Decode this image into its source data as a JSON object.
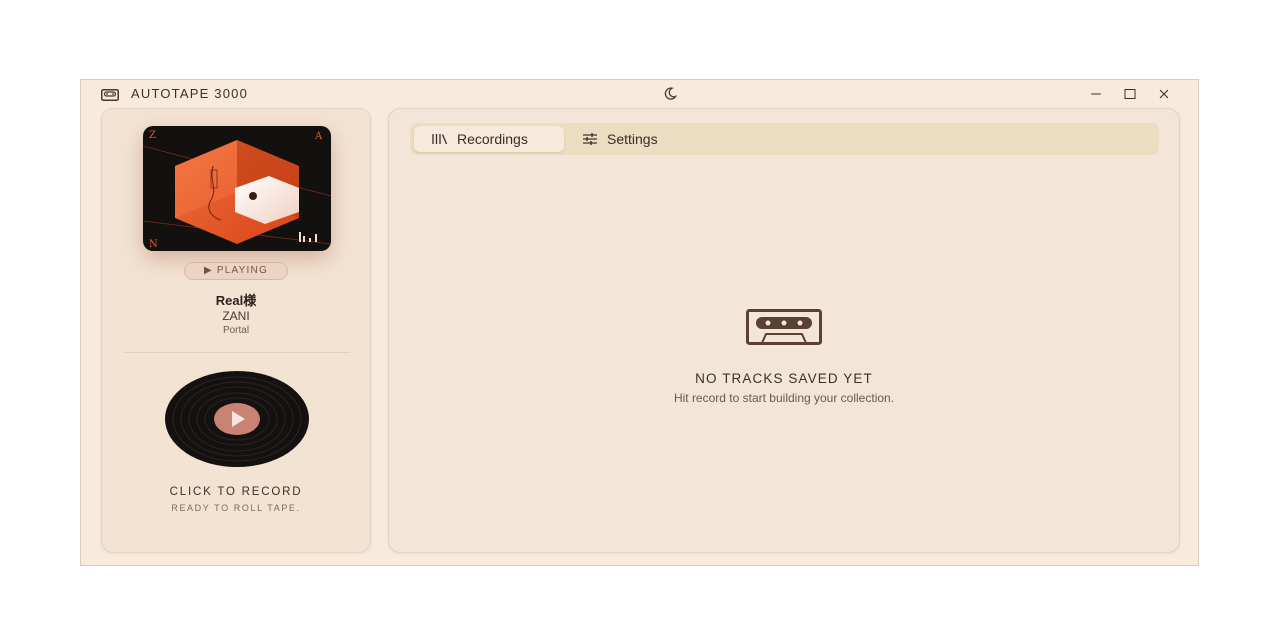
{
  "app": {
    "title": "AUTOTAPE 3000",
    "icons": {
      "app": "cassette-icon",
      "theme": "moon-icon",
      "minimize": "minimize-icon",
      "maximize": "maximize-icon",
      "close": "close-icon"
    }
  },
  "now_playing": {
    "status": "▶ PLAYING",
    "title": "Real様",
    "artist": "ZANI",
    "album": "Portal",
    "art_letters": {
      "top_left": "Z",
      "top_right": "A",
      "bottom_left": "N"
    }
  },
  "record": {
    "title": "CLICK TO RECORD",
    "subtitle": "READY TO ROLL TAPE."
  },
  "tabs": [
    {
      "label": "Recordings",
      "icon": "library-icon",
      "active": true
    },
    {
      "label": "Settings",
      "icon": "sliders-icon",
      "active": false
    }
  ],
  "empty_state": {
    "icon": "cassette-icon",
    "title": "NO TRACKS SAVED YET",
    "subtitle": "Hit record to start building your collection."
  },
  "colors": {
    "window_bg": "#f8ebde",
    "panel_bg": "#f3e5d7",
    "tab_bar": "#ecdcc2",
    "accent_orange": "#e65a2e",
    "play_button": "#c98372",
    "dark_brown": "#5a4134"
  }
}
